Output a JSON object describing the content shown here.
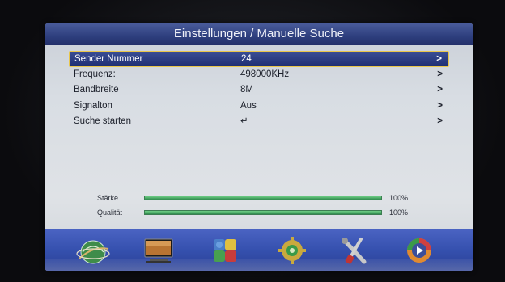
{
  "header": {
    "title": "Einstellungen / Manuelle Suche"
  },
  "menu": {
    "items": [
      {
        "label": "Sender Nummer",
        "value": "24",
        "arrow": ">"
      },
      {
        "label": "Frequenz:",
        "value": "498000KHz",
        "arrow": ">"
      },
      {
        "label": "Bandbreite",
        "value": "8M",
        "arrow": ">"
      },
      {
        "label": "Signalton",
        "value": "Aus",
        "arrow": ">"
      },
      {
        "label": "Suche starten",
        "value": "↵",
        "arrow": ">"
      }
    ],
    "selected_index": 0
  },
  "signal": {
    "strength": {
      "label": "Stärke",
      "percent_text": "100%",
      "level": 1.0
    },
    "quality": {
      "label": "Qualität",
      "percent_text": "100%",
      "level": 1.0
    }
  },
  "icons": [
    "globe-satellite-icon",
    "tv-monitor-icon",
    "puzzle-icon",
    "gear-settings-icon",
    "tools-icon",
    "media-play-icon"
  ],
  "colors": {
    "title_bar": "#2e3f7e",
    "selection_border": "#e9c64a",
    "signal_bar": "#2f8a4c",
    "icon_bar": "#3550ae"
  }
}
